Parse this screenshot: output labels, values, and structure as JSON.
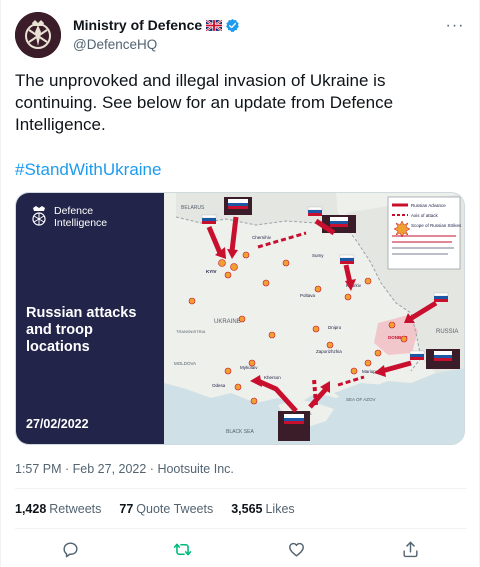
{
  "author": {
    "display_name": "Ministry of Defence",
    "handle": "@DefenceHQ",
    "icons": [
      "uk-flag-icon",
      "verified-badge-icon"
    ]
  },
  "tweet": {
    "text": "The unprovoked and illegal invasion of Ukraine is continuing. See below for an update from Defence Intelligence.",
    "hashtag": "#StandWithUkraine",
    "timestamp": "1:57 PM · Feb 27, 2022 · Hootsuite Inc."
  },
  "media": {
    "brand_line1": "Defence",
    "brand_line2": "Intelligence",
    "title": "Russian attacks and troop locations",
    "date": "27/02/2022",
    "map_labels": {
      "belarus": "BELARUS",
      "ukraine": "UKRAINE",
      "russia": "RUSSIA",
      "moldova": "MOLDOVA",
      "black_sea": "BLACK SEA",
      "sea_of_azov": "SEA OF AZOV",
      "kyiv": "KYIV",
      "kharkiv": "Kharkiv",
      "chernihiv": "Chernihiv",
      "sumy": "Sumy",
      "poltava": "Poltava",
      "dnipro": "Dnipro",
      "zaporizhzhia": "Zaporizhzhia",
      "mariupol": "Mariupol",
      "kherson": "Kherson",
      "mykolaiv": "Mykolaiv",
      "odesa": "Odesa",
      "donbas": "DONBAS",
      "transnistria": "TRANSNISTRIA",
      "crimea": "CRIMEA"
    },
    "groupings": {
      "central": "CENTRAL MD GROUPING",
      "western": "WESTERN MD GROUPING",
      "southern": "SOUTHERN MD GROUPING",
      "southern_airborne": "SOUTHERN MD & AIRBORNE GROUPING"
    },
    "legend": {
      "advance": "Russian Advance",
      "axis": "Axis of attack",
      "strikes": "Scope of Russian Strikes"
    },
    "colors": {
      "panel": "#22244a",
      "arrow": "#c8102e",
      "sea": "#cfe0e6",
      "land": "#eef0ec"
    }
  },
  "stats": {
    "retweets_count": "1,428",
    "retweets_label": "Retweets",
    "quotes_count": "77",
    "quotes_label": "Quote Tweets",
    "likes_count": "3,565",
    "likes_label": "Likes"
  },
  "actions": [
    "reply-icon",
    "retweet-icon",
    "like-icon",
    "share-icon"
  ],
  "colors": {
    "accent": "#1d9bf0",
    "retweet": "#00ba7c",
    "text_secondary": "#536471"
  }
}
